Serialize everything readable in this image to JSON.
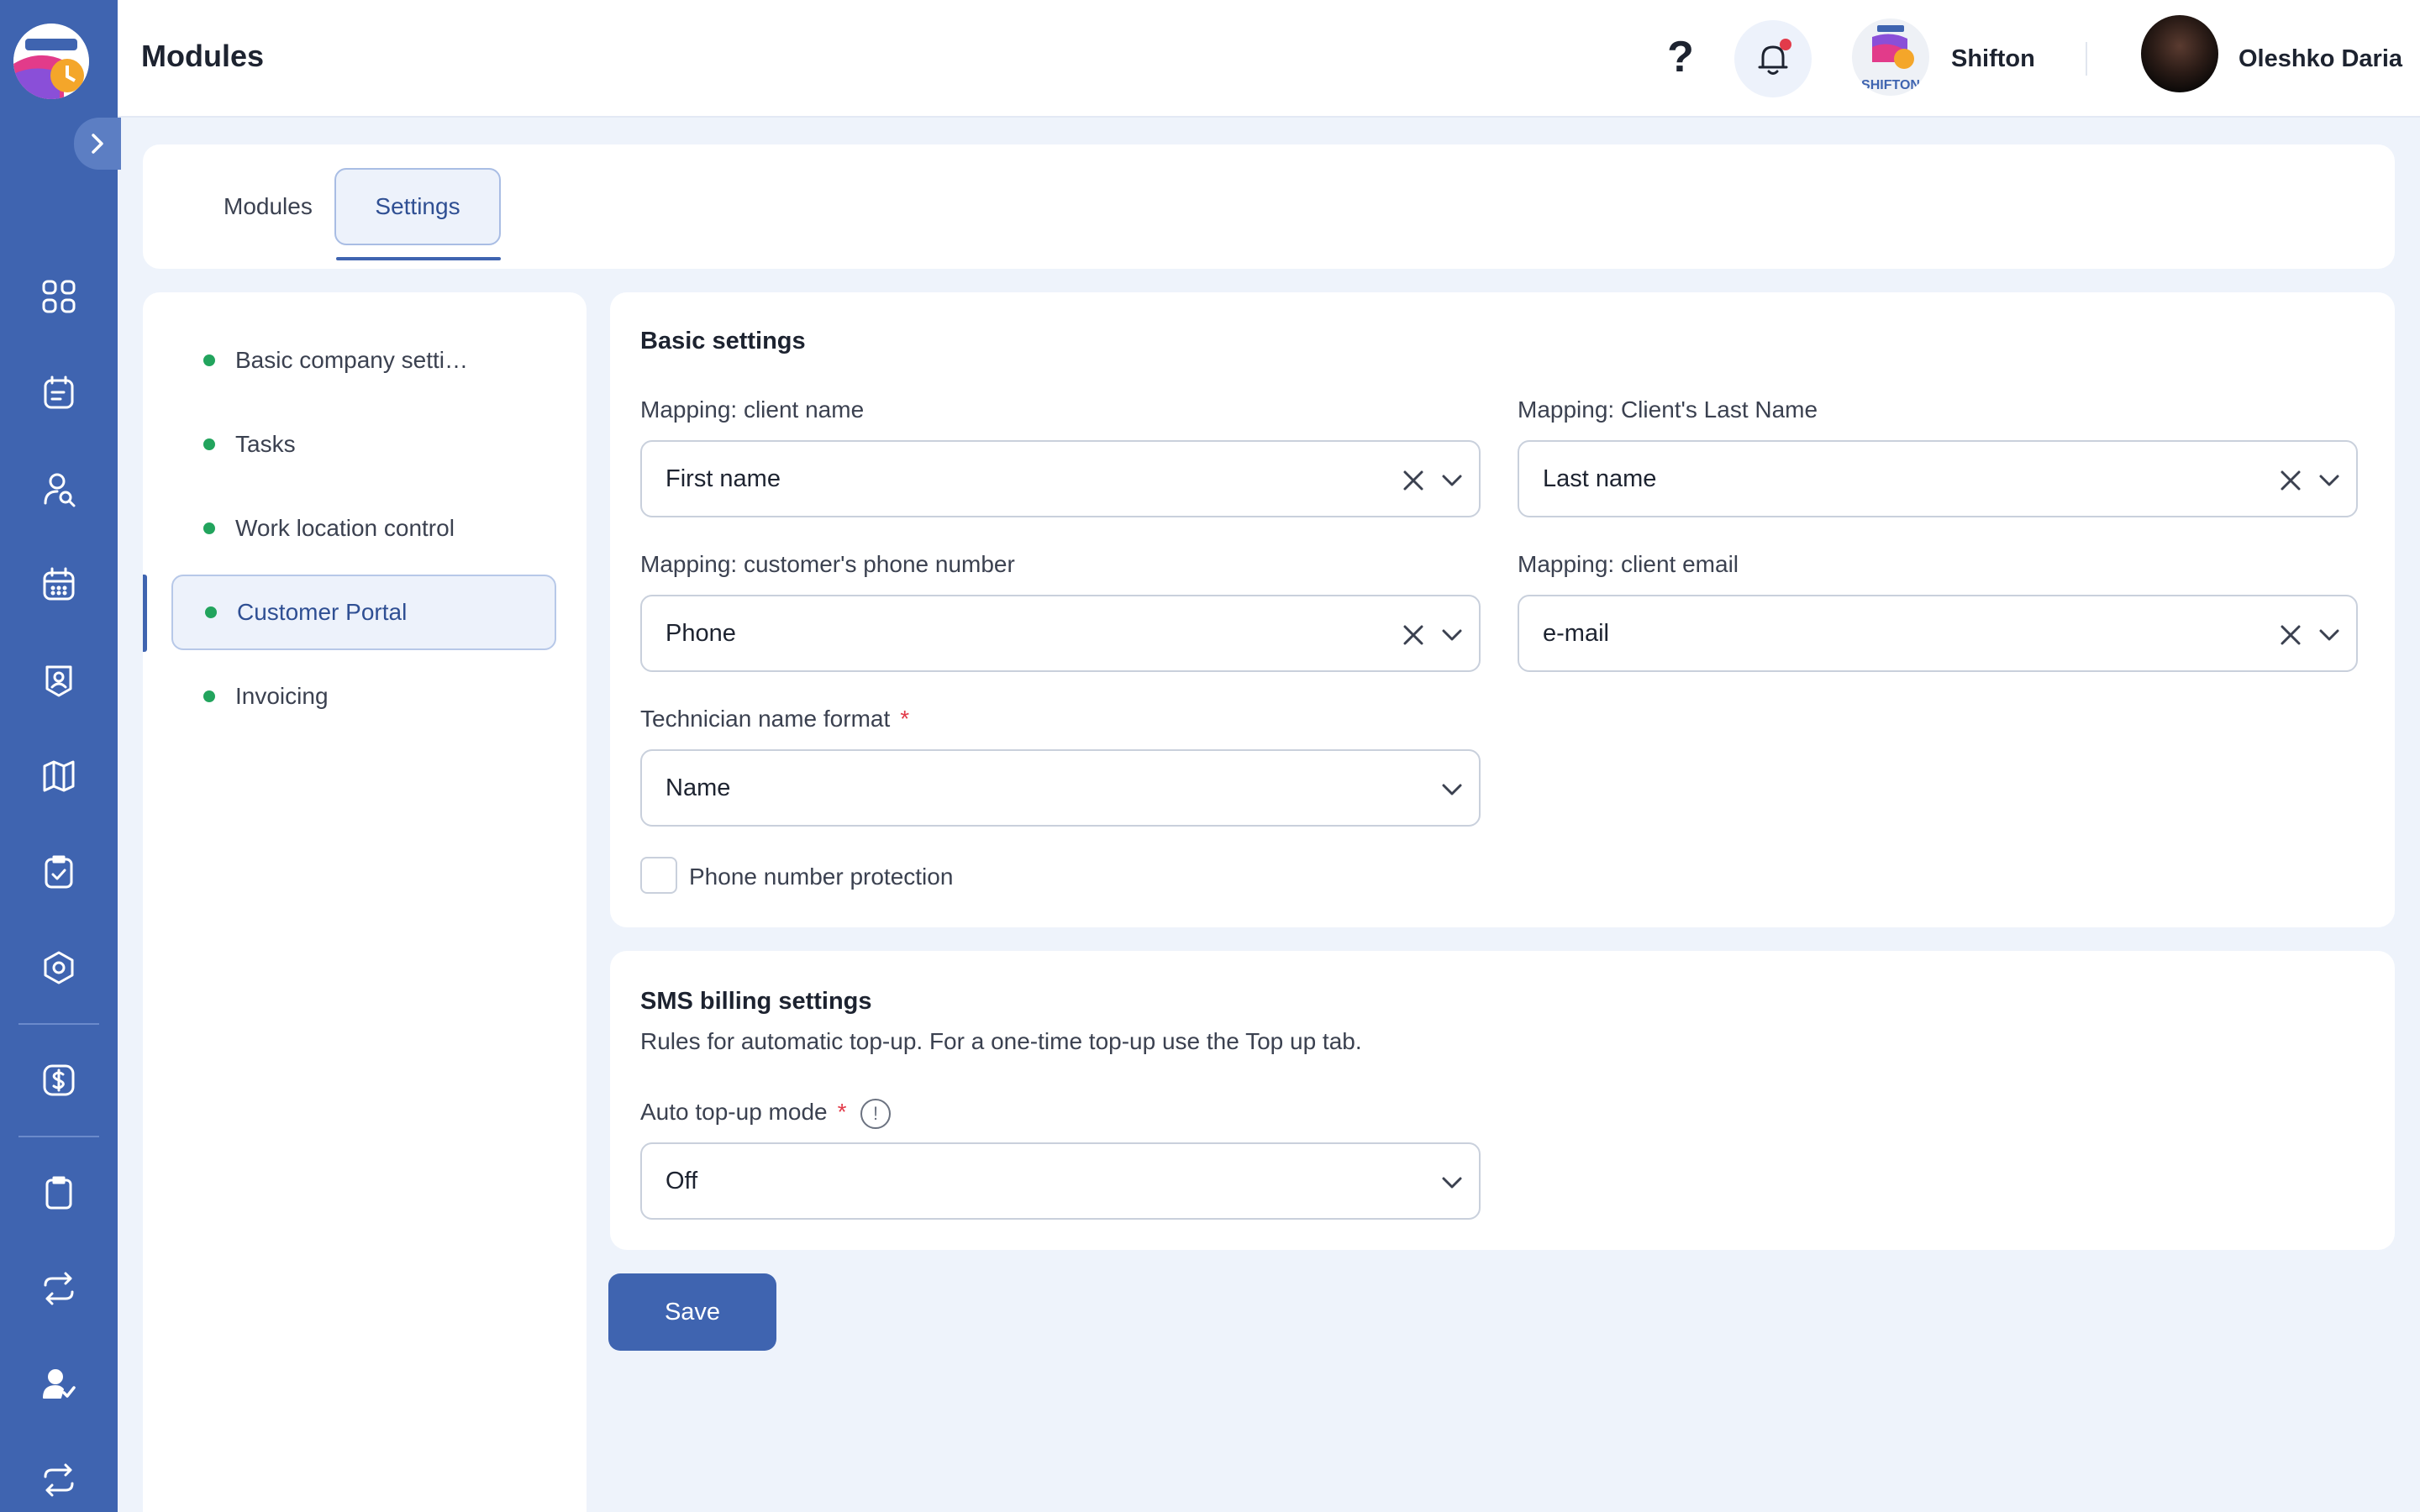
{
  "header": {
    "title": "Modules",
    "help_glyph": "?",
    "company_name": "Shifton",
    "user_name": "Oleshko Daria"
  },
  "tabs": [
    {
      "label": "Modules",
      "active": false
    },
    {
      "label": "Settings",
      "active": true
    }
  ],
  "nav": {
    "items": [
      {
        "label": "Basic company settings"
      },
      {
        "label": "Tasks"
      },
      {
        "label": "Work location control"
      },
      {
        "label": "Customer Portal",
        "active": true
      },
      {
        "label": "Invoicing"
      }
    ]
  },
  "basic": {
    "title": "Basic settings",
    "client_name": {
      "label": "Mapping: client name",
      "value": "First name"
    },
    "last_name": {
      "label": "Mapping: Client's Last Name",
      "value": "Last name"
    },
    "phone": {
      "label": "Mapping: customer's phone number",
      "value": "Phone"
    },
    "email": {
      "label": "Mapping: client email",
      "value": "e-mail"
    },
    "tech_format": {
      "label": "Technician name format",
      "required_mark": "*",
      "value": "Name"
    },
    "phone_protection": {
      "label": "Phone number protection",
      "checked": false
    }
  },
  "sms": {
    "title": "SMS billing settings",
    "description": "Rules for automatic top-up. For a one-time top-up use the Top up tab.",
    "auto_mode": {
      "label": "Auto top-up mode",
      "required_mark": "*",
      "value": "Off",
      "info_glyph": "!"
    }
  },
  "actions": {
    "save_label": "Save"
  },
  "colors": {
    "rail": "#3f64b0",
    "accent": "#3f64b0",
    "status_dot": "#22a45d",
    "notification_dot": "#e23b4a",
    "background": "#eef3fb"
  },
  "icons": {
    "rail": [
      "dashboard-icon",
      "schedule-list-icon",
      "user-search-icon",
      "calendar-icon",
      "badge-icon",
      "map-icon",
      "clipboard-check-icon",
      "settings-hex-icon",
      "billing-icon",
      "clipboard-icon",
      "sync-icon",
      "user-check-icon",
      "repeat-icon"
    ]
  }
}
